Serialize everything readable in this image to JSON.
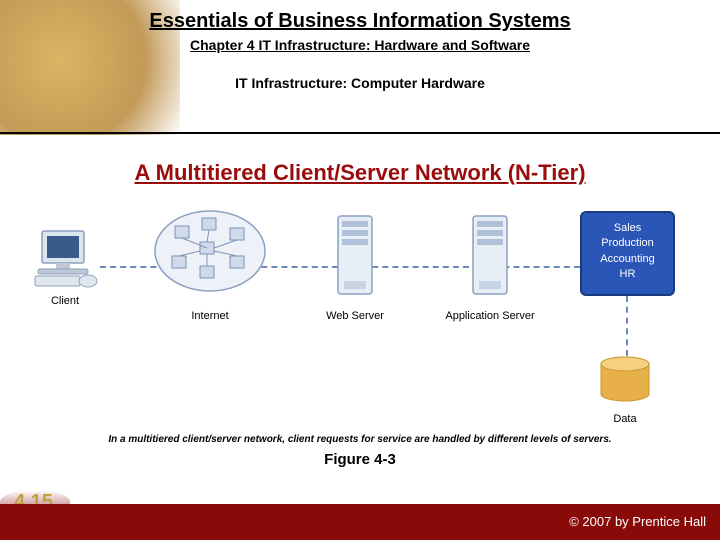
{
  "header": {
    "main_title": "Essentials of Business Information Systems",
    "subtitle": "Chapter 4 IT Infrastructure: Hardware and Software",
    "section": "IT Infrastructure: Computer Hardware"
  },
  "heading": "A Multitiered Client/Server Network (N-Tier)",
  "diagram": {
    "client_label": "Client",
    "internet_label": "Internet",
    "webserver_label": "Web Server",
    "appserver_label": "Application Server",
    "apps_line1": "Sales",
    "apps_line2": "Production",
    "apps_line3": "Accounting",
    "apps_line4": "HR",
    "data_label": "Data"
  },
  "caption": "In a multitiered client/server network, client requests for service are handled by different levels of servers.",
  "figure_label": "Figure 4-3",
  "footer": {
    "page": "4.15",
    "copyright": "© 2007 by Prentice Hall"
  }
}
